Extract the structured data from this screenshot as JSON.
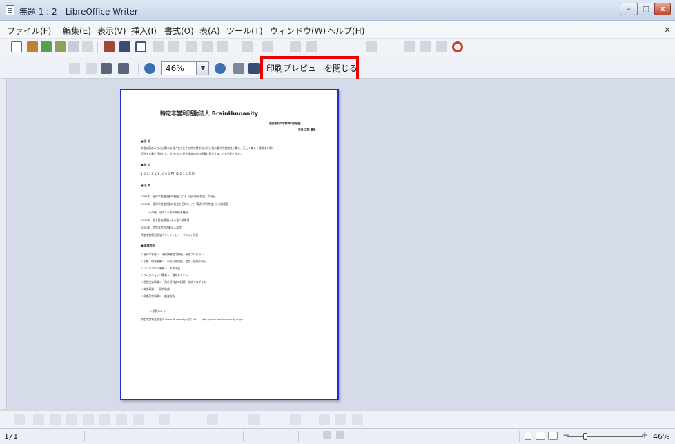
{
  "window": {
    "title": "無題 1 : 2 - LibreOffice Writer",
    "min": "–",
    "max": "□",
    "close": "x"
  },
  "menubar": {
    "items": [
      "ファイル(F)",
      "編集(E)",
      "表示(V)",
      "挿入(I)",
      "書式(O)",
      "表(A)",
      "ツール(T)",
      "ウィンドウ(W)",
      "ヘルプ(H)"
    ],
    "close_doc": "×"
  },
  "preview_toolbar": {
    "zoom_value": "46%",
    "close_preview_label": "印刷プレビューを閉じる"
  },
  "document": {
    "title": "特定非営利活動法人 BrainHumanity",
    "subtitle1": "独協医科大学精神科学講座",
    "subtitle2": "会長 北野 慶寿",
    "purpose_heading": "■ 目 的",
    "purpose_text1": "本会は脳および心に関わる個人並びにその他の関係者に対し脳の働きや機能性に関し、正しく楽しく理解する場を",
    "purpose_text2": "提供する事を目的とし、もって広く社会全般の心の健康に寄与することを目的とする。",
    "founded_heading": "■ 設 立",
    "founded_text": "1 0 3、9 1 1 : 0 0 0 円（2 0 1 0 年度）",
    "history_heading": "■ 沿 革",
    "history": [
      "1994年　脳科学推進活動の開始による「脳科学研究会」の発足",
      "1995年　脳科学推進活動の拡充を目的として「脳科学研究会」に名称変更",
      "　　　その後、セミナー等の開催を継続",
      "1999年　設立総会開催による法人格取得",
      "2000年　特定非営利活動法人認定",
      "特定非営利活動法人ブレインヒューマニティ発足"
    ],
    "activities_heading": "■ 事業内容",
    "activities": [
      "＜脳科学事業＞　学術講演会の開催、研修プログラム",
      "＜広報・啓発事業＞　市民公開講座、会誌・会報の発行",
      "＜シンポジウム事業＞　年次大会",
      "＜ワークショップ事業＞　地域セミナー",
      "＜国際交流事業＞　海外研究者の招聘、交流プログラム",
      "＜助成事業＞　研究助成",
      "＜調査研究事業＞　調査報告"
    ],
    "contact_heading": "＜ 参照URL ＞",
    "contact_text": "特定非営利活動法人 Brain Humanity 公式 HP　　http://www.brainhumanity.or.jp/"
  },
  "statusbar": {
    "page": "1/1",
    "zoom": "46%"
  },
  "colors": {
    "page_border": "#1f2fd0",
    "highlight": "#e60000",
    "workspace": "#d6dbe9"
  }
}
